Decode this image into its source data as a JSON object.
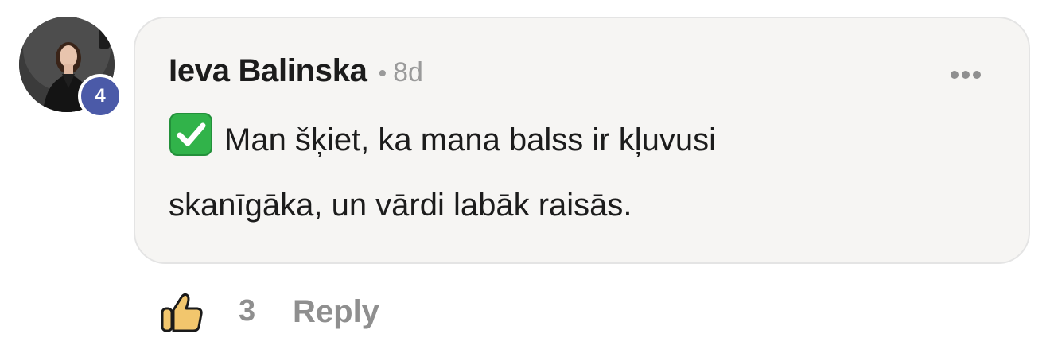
{
  "comment": {
    "author": "Ieva Balinska",
    "separator": "•",
    "time_ago": "8d",
    "level_badge": "4",
    "text": "Man šķiet, ka mana balss ir kļuvusi skanīgāka, un vārdi labāk raisās.",
    "leading_icon": "check-mark-button-icon",
    "more_icon": "more-options-icon"
  },
  "actions": {
    "like_icon": "thumbs-up-icon",
    "like_count": "3",
    "reply_label": "Reply"
  },
  "colors": {
    "bubble_background": "#f6f5f3",
    "bubble_border": "#e4e4e4",
    "badge": "#4b5aa8",
    "muted_text": "#8f8f8f",
    "check_green": "#31b34a",
    "thumb_yellow": "#f2c66d"
  }
}
